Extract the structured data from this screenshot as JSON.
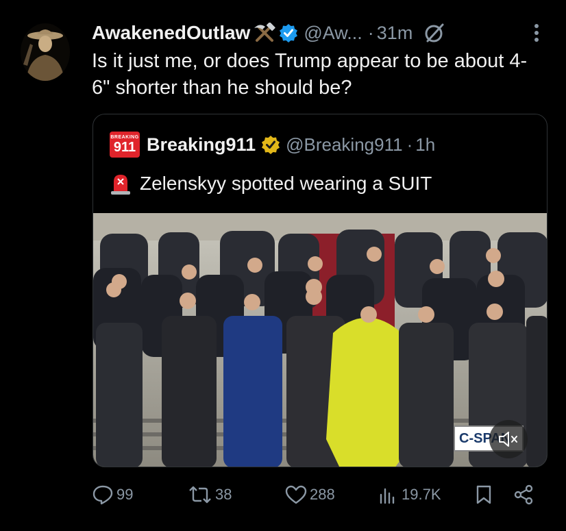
{
  "tweet": {
    "author_name": "AwakenedOutlaw",
    "handle": "@Aw...",
    "time": "31m",
    "text": "Is it just me, or does Trump appear to be about 4-6\" shorter than he should be?"
  },
  "quoted": {
    "logo_line1": "BREAKING",
    "logo_line2": "911",
    "author_name": "Breaking911",
    "handle": "@Breaking911",
    "time": "1h",
    "text": "Zelenskyy spotted wearing a SUIT",
    "watermark": "C-SPAN"
  },
  "actions": {
    "replies": "99",
    "reposts": "38",
    "likes": "288",
    "views": "19.7K"
  },
  "colors": {
    "background": "#000000",
    "secondary_text": "#8b98a5",
    "verified_blue": "#1d9bf0",
    "verified_gold": "#e2b719",
    "dress_yellow": "#d9de2a"
  },
  "icons": [
    "pickaxe-hammer-icon",
    "verified-badge-icon",
    "grok-icon",
    "more-options-icon",
    "siren-icon",
    "mute-icon",
    "reply-icon",
    "repost-icon",
    "like-icon",
    "views-icon",
    "bookmark-icon",
    "share-icon"
  ]
}
